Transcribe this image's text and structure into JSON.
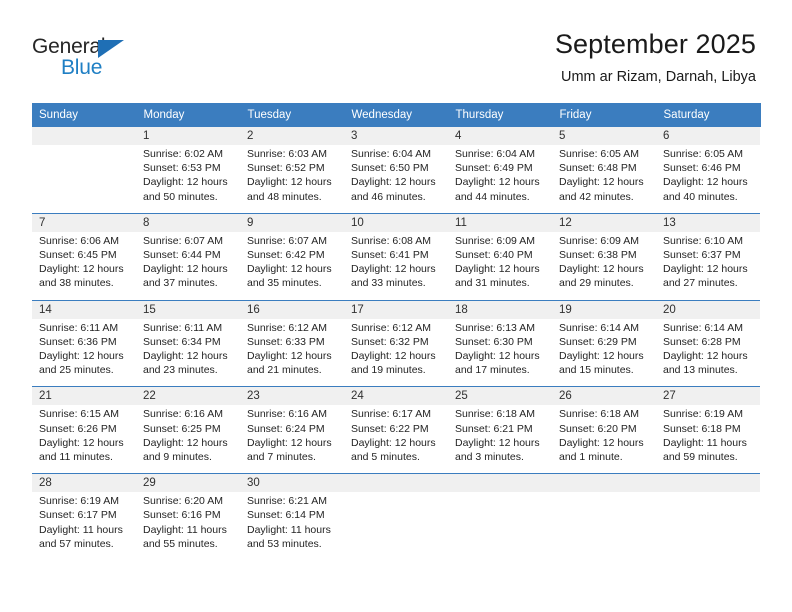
{
  "brand": {
    "name_part1": "General",
    "name_part2": "Blue",
    "accent_color": "#1f7fc4",
    "triangle_color": "#1f6fb5"
  },
  "header": {
    "title": "September 2025",
    "subtitle": "Umm ar Rizam, Darnah, Libya"
  },
  "theme": {
    "header_bg": "#3B7DBF",
    "daynum_bg": "#F0F0F0",
    "cell_bg": "#FFFFFF",
    "text_color": "#242424"
  },
  "weekdays": [
    "Sunday",
    "Monday",
    "Tuesday",
    "Wednesday",
    "Thursday",
    "Friday",
    "Saturday"
  ],
  "weeks": [
    {
      "days": [
        {
          "num": "",
          "sunrise": "",
          "sunset": "",
          "daylight1": "",
          "daylight2": "",
          "empty": true
        },
        {
          "num": "1",
          "sunrise": "Sunrise: 6:02 AM",
          "sunset": "Sunset: 6:53 PM",
          "daylight1": "Daylight: 12 hours",
          "daylight2": "and 50 minutes."
        },
        {
          "num": "2",
          "sunrise": "Sunrise: 6:03 AM",
          "sunset": "Sunset: 6:52 PM",
          "daylight1": "Daylight: 12 hours",
          "daylight2": "and 48 minutes."
        },
        {
          "num": "3",
          "sunrise": "Sunrise: 6:04 AM",
          "sunset": "Sunset: 6:50 PM",
          "daylight1": "Daylight: 12 hours",
          "daylight2": "and 46 minutes."
        },
        {
          "num": "4",
          "sunrise": "Sunrise: 6:04 AM",
          "sunset": "Sunset: 6:49 PM",
          "daylight1": "Daylight: 12 hours",
          "daylight2": "and 44 minutes."
        },
        {
          "num": "5",
          "sunrise": "Sunrise: 6:05 AM",
          "sunset": "Sunset: 6:48 PM",
          "daylight1": "Daylight: 12 hours",
          "daylight2": "and 42 minutes."
        },
        {
          "num": "6",
          "sunrise": "Sunrise: 6:05 AM",
          "sunset": "Sunset: 6:46 PM",
          "daylight1": "Daylight: 12 hours",
          "daylight2": "and 40 minutes."
        }
      ]
    },
    {
      "days": [
        {
          "num": "7",
          "sunrise": "Sunrise: 6:06 AM",
          "sunset": "Sunset: 6:45 PM",
          "daylight1": "Daylight: 12 hours",
          "daylight2": "and 38 minutes."
        },
        {
          "num": "8",
          "sunrise": "Sunrise: 6:07 AM",
          "sunset": "Sunset: 6:44 PM",
          "daylight1": "Daylight: 12 hours",
          "daylight2": "and 37 minutes."
        },
        {
          "num": "9",
          "sunrise": "Sunrise: 6:07 AM",
          "sunset": "Sunset: 6:42 PM",
          "daylight1": "Daylight: 12 hours",
          "daylight2": "and 35 minutes."
        },
        {
          "num": "10",
          "sunrise": "Sunrise: 6:08 AM",
          "sunset": "Sunset: 6:41 PM",
          "daylight1": "Daylight: 12 hours",
          "daylight2": "and 33 minutes."
        },
        {
          "num": "11",
          "sunrise": "Sunrise: 6:09 AM",
          "sunset": "Sunset: 6:40 PM",
          "daylight1": "Daylight: 12 hours",
          "daylight2": "and 31 minutes."
        },
        {
          "num": "12",
          "sunrise": "Sunrise: 6:09 AM",
          "sunset": "Sunset: 6:38 PM",
          "daylight1": "Daylight: 12 hours",
          "daylight2": "and 29 minutes."
        },
        {
          "num": "13",
          "sunrise": "Sunrise: 6:10 AM",
          "sunset": "Sunset: 6:37 PM",
          "daylight1": "Daylight: 12 hours",
          "daylight2": "and 27 minutes."
        }
      ]
    },
    {
      "days": [
        {
          "num": "14",
          "sunrise": "Sunrise: 6:11 AM",
          "sunset": "Sunset: 6:36 PM",
          "daylight1": "Daylight: 12 hours",
          "daylight2": "and 25 minutes."
        },
        {
          "num": "15",
          "sunrise": "Sunrise: 6:11 AM",
          "sunset": "Sunset: 6:34 PM",
          "daylight1": "Daylight: 12 hours",
          "daylight2": "and 23 minutes."
        },
        {
          "num": "16",
          "sunrise": "Sunrise: 6:12 AM",
          "sunset": "Sunset: 6:33 PM",
          "daylight1": "Daylight: 12 hours",
          "daylight2": "and 21 minutes."
        },
        {
          "num": "17",
          "sunrise": "Sunrise: 6:12 AM",
          "sunset": "Sunset: 6:32 PM",
          "daylight1": "Daylight: 12 hours",
          "daylight2": "and 19 minutes."
        },
        {
          "num": "18",
          "sunrise": "Sunrise: 6:13 AM",
          "sunset": "Sunset: 6:30 PM",
          "daylight1": "Daylight: 12 hours",
          "daylight2": "and 17 minutes."
        },
        {
          "num": "19",
          "sunrise": "Sunrise: 6:14 AM",
          "sunset": "Sunset: 6:29 PM",
          "daylight1": "Daylight: 12 hours",
          "daylight2": "and 15 minutes."
        },
        {
          "num": "20",
          "sunrise": "Sunrise: 6:14 AM",
          "sunset": "Sunset: 6:28 PM",
          "daylight1": "Daylight: 12 hours",
          "daylight2": "and 13 minutes."
        }
      ]
    },
    {
      "days": [
        {
          "num": "21",
          "sunrise": "Sunrise: 6:15 AM",
          "sunset": "Sunset: 6:26 PM",
          "daylight1": "Daylight: 12 hours",
          "daylight2": "and 11 minutes."
        },
        {
          "num": "22",
          "sunrise": "Sunrise: 6:16 AM",
          "sunset": "Sunset: 6:25 PM",
          "daylight1": "Daylight: 12 hours",
          "daylight2": "and 9 minutes."
        },
        {
          "num": "23",
          "sunrise": "Sunrise: 6:16 AM",
          "sunset": "Sunset: 6:24 PM",
          "daylight1": "Daylight: 12 hours",
          "daylight2": "and 7 minutes."
        },
        {
          "num": "24",
          "sunrise": "Sunrise: 6:17 AM",
          "sunset": "Sunset: 6:22 PM",
          "daylight1": "Daylight: 12 hours",
          "daylight2": "and 5 minutes."
        },
        {
          "num": "25",
          "sunrise": "Sunrise: 6:18 AM",
          "sunset": "Sunset: 6:21 PM",
          "daylight1": "Daylight: 12 hours",
          "daylight2": "and 3 minutes."
        },
        {
          "num": "26",
          "sunrise": "Sunrise: 6:18 AM",
          "sunset": "Sunset: 6:20 PM",
          "daylight1": "Daylight: 12 hours",
          "daylight2": "and 1 minute."
        },
        {
          "num": "27",
          "sunrise": "Sunrise: 6:19 AM",
          "sunset": "Sunset: 6:18 PM",
          "daylight1": "Daylight: 11 hours",
          "daylight2": "and 59 minutes."
        }
      ]
    },
    {
      "days": [
        {
          "num": "28",
          "sunrise": "Sunrise: 6:19 AM",
          "sunset": "Sunset: 6:17 PM",
          "daylight1": "Daylight: 11 hours",
          "daylight2": "and 57 minutes."
        },
        {
          "num": "29",
          "sunrise": "Sunrise: 6:20 AM",
          "sunset": "Sunset: 6:16 PM",
          "daylight1": "Daylight: 11 hours",
          "daylight2": "and 55 minutes."
        },
        {
          "num": "30",
          "sunrise": "Sunrise: 6:21 AM",
          "sunset": "Sunset: 6:14 PM",
          "daylight1": "Daylight: 11 hours",
          "daylight2": "and 53 minutes."
        },
        {
          "num": "",
          "sunrise": "",
          "sunset": "",
          "daylight1": "",
          "daylight2": "",
          "empty": true
        },
        {
          "num": "",
          "sunrise": "",
          "sunset": "",
          "daylight1": "",
          "daylight2": "",
          "empty": true
        },
        {
          "num": "",
          "sunrise": "",
          "sunset": "",
          "daylight1": "",
          "daylight2": "",
          "empty": true
        },
        {
          "num": "",
          "sunrise": "",
          "sunset": "",
          "daylight1": "",
          "daylight2": "",
          "empty": true
        }
      ]
    }
  ]
}
